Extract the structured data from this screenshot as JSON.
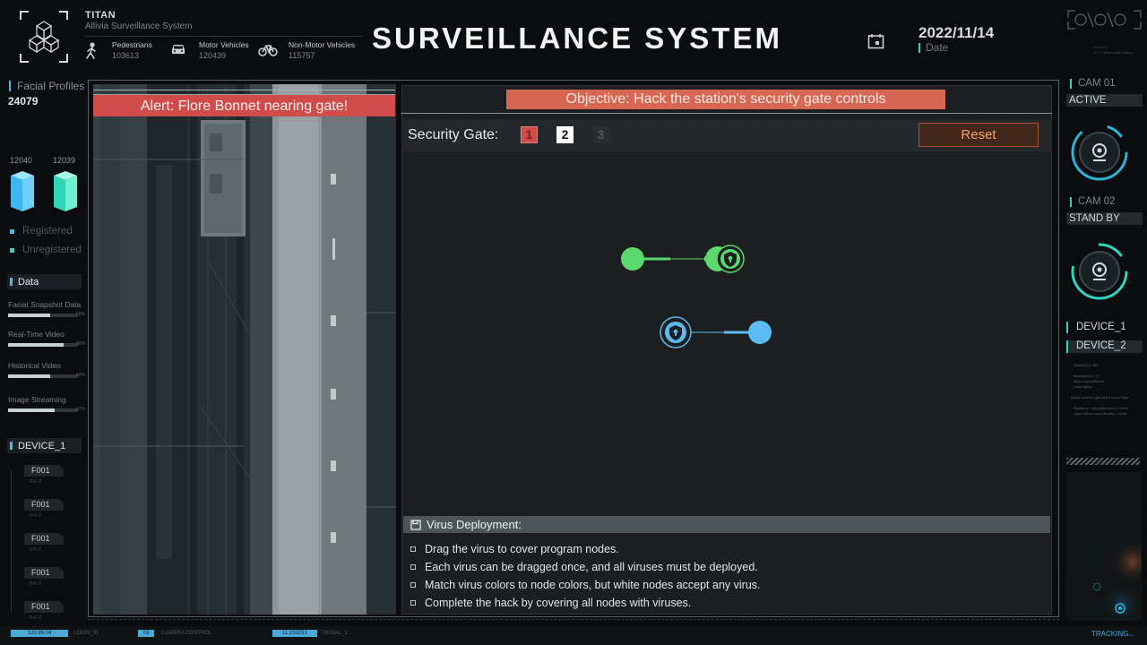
{
  "header": {
    "brand_title": "TITAN",
    "brand_subtitle": "Allivia Surveillance System",
    "main_title": "SURVEILLANCE  SYSTEM",
    "date_value": "2022/11/14",
    "date_label": "Date",
    "stats": [
      {
        "label": "Pedestrians",
        "value": "103613",
        "icon": "pedestrian-icon"
      },
      {
        "label": "Motor Vehicles",
        "value": "120439",
        "icon": "car-icon"
      },
      {
        "label": "Non-Motor Vehicles",
        "value": "115757",
        "icon": "bicycle-icon"
      }
    ]
  },
  "left_sidebar": {
    "facial_profiles_label": "Facial Profiles",
    "facial_profiles_value": "24079",
    "registered_count": "12040",
    "unregistered_count": "12039",
    "registered_label": "Registered",
    "unregistered_label": "Unregistered",
    "data_label": "Data",
    "metrics": [
      {
        "label": "Facial Snapshot Data",
        "percent": 60,
        "pct_text": "60%"
      },
      {
        "label": "Real-Time Video",
        "percent": 80,
        "pct_text": "80%"
      },
      {
        "label": "Historical Video",
        "percent": 60,
        "pct_text": "60%"
      },
      {
        "label": "Image Streaming",
        "percent": 67,
        "pct_text": "67%"
      }
    ],
    "device_label": "DEVICE_1",
    "tags": [
      {
        "label": "F001",
        "sub": "0-F-2"
      },
      {
        "label": "F001",
        "sub": "0-F-2"
      },
      {
        "label": "F001",
        "sub": "0-F-2"
      },
      {
        "label": "F001",
        "sub": "0-F-2"
      },
      {
        "label": "F001",
        "sub": "0-F-2"
      }
    ]
  },
  "camera": {
    "alert_text": "Alert: Flore Bonnet nearing gate!"
  },
  "game": {
    "objective_text": "Objective: Hack the station's security gate controls",
    "gate_label": "Security Gate:",
    "gates": [
      "1",
      "2",
      "3"
    ],
    "reset_label": "Reset",
    "instructions_title": "Virus Deployment:",
    "instructions": [
      "Drag the virus to cover program nodes.",
      "Each virus can be dragged once, and all viruses must be deployed.",
      "Match virus colors to node colors, but white nodes accept any virus.",
      "Complete the hack by covering all nodes with viruses."
    ],
    "colors": {
      "green": "#5bd96e",
      "blue": "#5bbcf5",
      "alert": "#cf4c4a",
      "objective": "#d76652",
      "reset_text": "#f3a06b"
    }
  },
  "right_sidebar": {
    "cam1_label": "CAM 01",
    "cam1_status": "ACTIVE",
    "cam2_label": "CAM 02",
    "cam2_status": "STAND BY",
    "device1": "DEVICE_1",
    "device2": "DEVICE_2"
  },
  "footer": {
    "v1": "120.99.04",
    "l1": "LOGIN_ID",
    "v2": "03",
    "l2": "CAMERA CONTROL",
    "v3": "11.233251",
    "l3": "SIGNAL_1",
    "tracking": "TRACKING..."
  }
}
